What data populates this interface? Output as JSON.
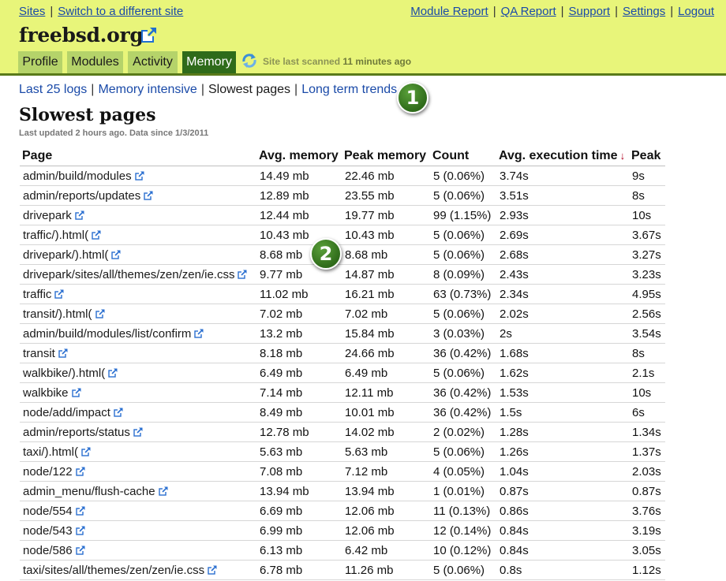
{
  "top_nav": {
    "left": [
      "Sites",
      "Switch to a different site"
    ],
    "right": [
      "Module Report",
      "QA Report",
      "Support",
      "Settings",
      "Logout"
    ]
  },
  "site": {
    "title": "freebsd.org"
  },
  "tabs": [
    "Profile",
    "Modules",
    "Activity",
    "Memory"
  ],
  "scan": {
    "prefix": "Site last scanned ",
    "time": "11 minutes ago"
  },
  "subnav": [
    "Last 25 logs",
    "Memory intensive",
    "Slowest pages",
    "Long term trends"
  ],
  "badges": [
    "1",
    "2"
  ],
  "page": {
    "title": "Slowest pages",
    "last_updated": "Last updated 2 hours ago. Data since 1/3/2011"
  },
  "table": {
    "headers": [
      "Page",
      "Avg. memory",
      "Peak memory",
      "Count",
      "Avg. execution time",
      "Peak"
    ],
    "sort_indicator": "↓",
    "rows": [
      [
        "admin/build/modules",
        "14.49 mb",
        "22.46 mb",
        "5 (0.06%)",
        "3.74s",
        "9s"
      ],
      [
        "admin/reports/updates",
        "12.89 mb",
        "23.55 mb",
        "5 (0.06%)",
        "3.51s",
        "8s"
      ],
      [
        "drivepark",
        "12.44 mb",
        "19.77 mb",
        "99 (1.15%)",
        "2.93s",
        "10s"
      ],
      [
        "traffic/).html(",
        "10.43 mb",
        "10.43 mb",
        "5 (0.06%)",
        "2.69s",
        "3.67s"
      ],
      [
        "drivepark/).html(",
        "8.68 mb",
        "8.68 mb",
        "5 (0.06%)",
        "2.68s",
        "3.27s"
      ],
      [
        "drivepark/sites/all/themes/zen/zen/ie.css",
        "9.77 mb",
        "14.87 mb",
        "8 (0.09%)",
        "2.43s",
        "3.23s"
      ],
      [
        "traffic",
        "11.02 mb",
        "16.21 mb",
        "63 (0.73%)",
        "2.34s",
        "4.95s"
      ],
      [
        "transit/).html(",
        "7.02 mb",
        "7.02 mb",
        "5 (0.06%)",
        "2.02s",
        "2.56s"
      ],
      [
        "admin/build/modules/list/confirm",
        "13.2 mb",
        "15.84 mb",
        "3 (0.03%)",
        "2s",
        "3.54s"
      ],
      [
        "transit",
        "8.18 mb",
        "24.66 mb",
        "36 (0.42%)",
        "1.68s",
        "8s"
      ],
      [
        "walkbike/).html(",
        "6.49 mb",
        "6.49 mb",
        "5 (0.06%)",
        "1.62s",
        "2.1s"
      ],
      [
        "walkbike",
        "7.14 mb",
        "12.11 mb",
        "36 (0.42%)",
        "1.53s",
        "10s"
      ],
      [
        "node/add/impact",
        "8.49 mb",
        "10.01 mb",
        "36 (0.42%)",
        "1.5s",
        "6s"
      ],
      [
        "admin/reports/status",
        "12.78 mb",
        "14.02 mb",
        "2 (0.02%)",
        "1.28s",
        "1.34s"
      ],
      [
        "taxi/).html(",
        "5.63 mb",
        "5.63 mb",
        "5 (0.06%)",
        "1.26s",
        "1.37s"
      ],
      [
        "node/122",
        "7.08 mb",
        "7.12 mb",
        "4 (0.05%)",
        "1.04s",
        "2.03s"
      ],
      [
        "admin_menu/flush-cache",
        "13.94 mb",
        "13.94 mb",
        "1 (0.01%)",
        "0.87s",
        "0.87s"
      ],
      [
        "node/554",
        "6.69 mb",
        "12.06 mb",
        "11 (0.13%)",
        "0.86s",
        "3.76s"
      ],
      [
        "node/543",
        "6.99 mb",
        "12.06 mb",
        "12 (0.14%)",
        "0.84s",
        "3.19s"
      ],
      [
        "node/586",
        "6.13 mb",
        "6.42 mb",
        "10 (0.12%)",
        "0.84s",
        "3.05s"
      ],
      [
        "taxi/sites/all/themes/zen/zen/ie.css",
        "6.78 mb",
        "11.26 mb",
        "5 (0.06%)",
        "0.8s",
        "1.12s"
      ]
    ]
  }
}
